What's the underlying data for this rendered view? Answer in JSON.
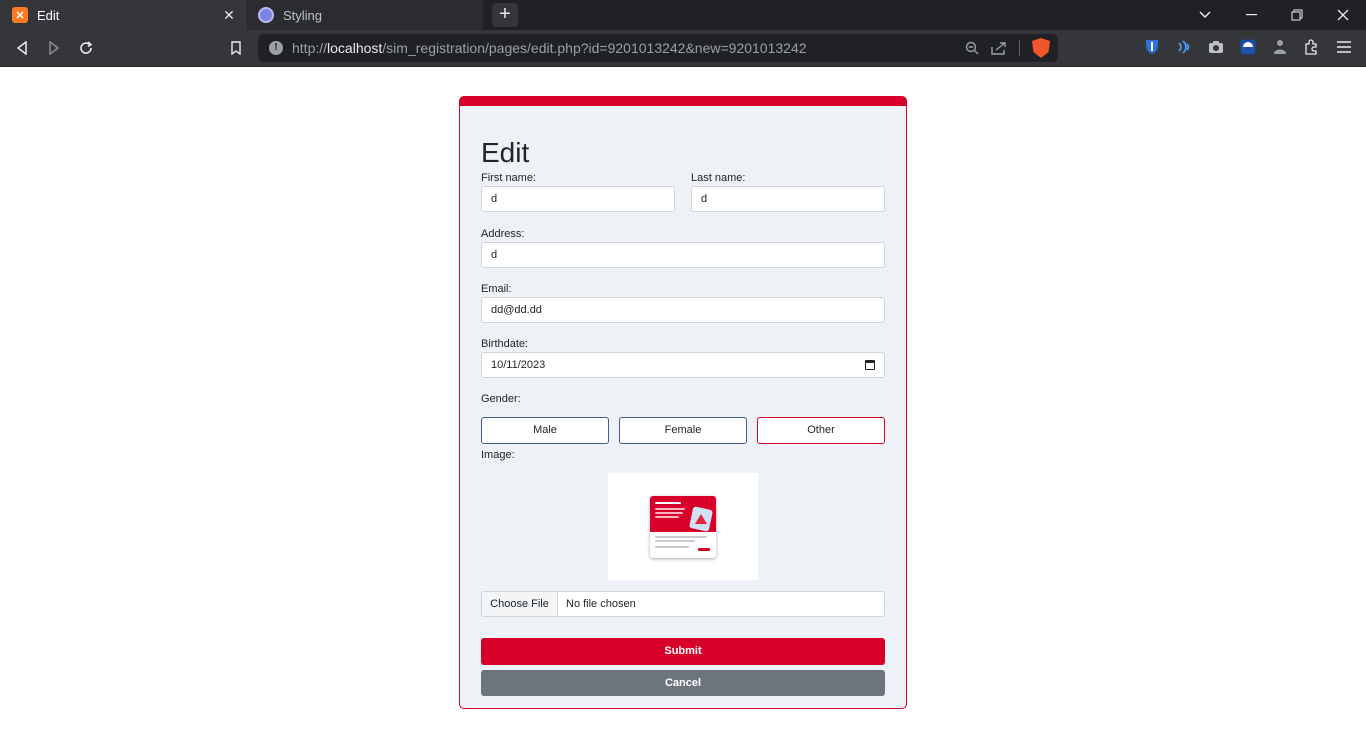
{
  "browser": {
    "tabs": [
      {
        "title": "Edit",
        "icon": "xampp-icon",
        "active": true
      },
      {
        "title": "Styling",
        "icon": "globe-icon",
        "active": false
      }
    ],
    "url": {
      "scheme": "http://",
      "host": "localhost",
      "path": "/sim_registration/pages/edit.php?id=9201013242&new=9201013242"
    }
  },
  "form": {
    "title": "Edit",
    "first_name": {
      "label": "First name:",
      "value": "d"
    },
    "last_name": {
      "label": "Last name:",
      "value": "d"
    },
    "address": {
      "label": "Address:",
      "value": "d"
    },
    "email": {
      "label": "Email:",
      "value": "dd@dd.dd"
    },
    "birthdate": {
      "label": "Birthdate:",
      "value": "10/11/2023"
    },
    "gender": {
      "label": "Gender:",
      "options": [
        "Male",
        "Female",
        "Other"
      ],
      "selected": "Other"
    },
    "image": {
      "label": "Image:",
      "file_button": "Choose File",
      "file_status": "No file chosen"
    },
    "submit_label": "Submit",
    "cancel_label": "Cancel"
  },
  "colors": {
    "accent": "#d7002a",
    "card_bg": "#eef2f6",
    "cancel": "#6c757d",
    "chrome_dark": "#202124",
    "chrome": "#35363a"
  }
}
